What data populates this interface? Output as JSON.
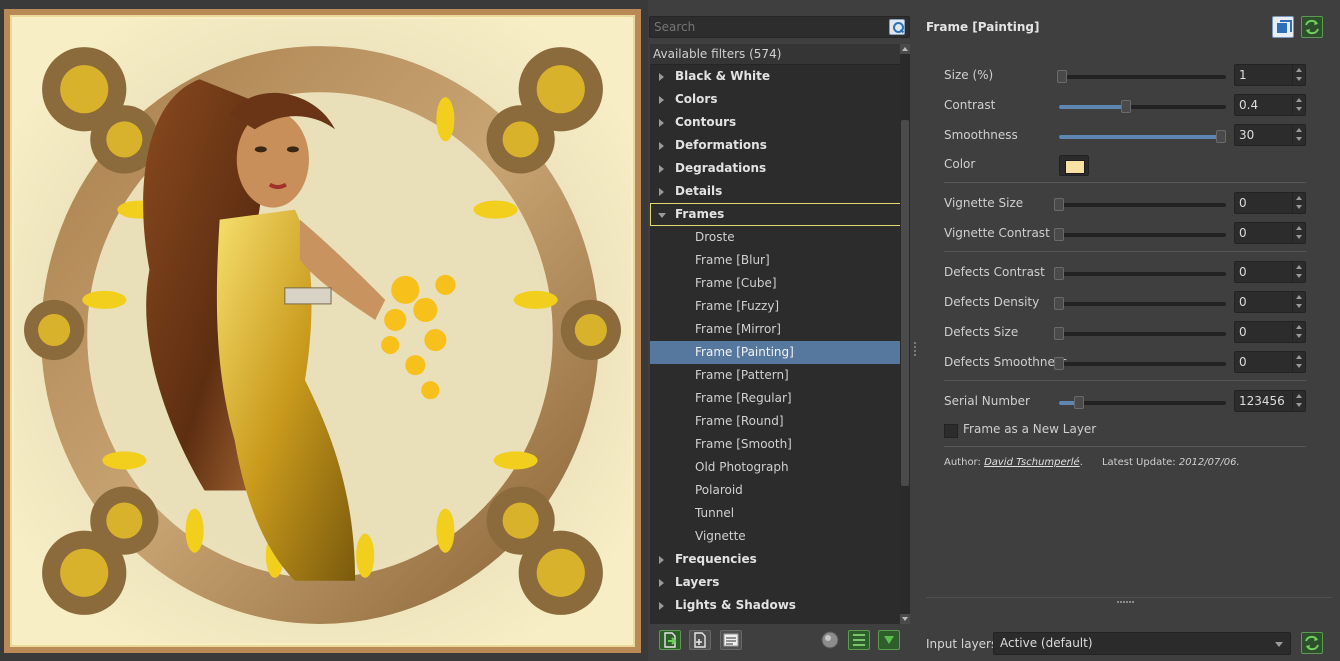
{
  "search": {
    "placeholder": "Search"
  },
  "tree": {
    "header": "Available filters (574)",
    "categories_before": [
      "Black & White",
      "Colors",
      "Contours",
      "Deformations",
      "Degradations",
      "Details"
    ],
    "open_category": "Frames",
    "frames_items": [
      "Droste",
      "Frame [Blur]",
      "Frame [Cube]",
      "Frame [Fuzzy]",
      "Frame [Mirror]",
      "Frame [Painting]",
      "Frame [Pattern]",
      "Frame [Regular]",
      "Frame [Round]",
      "Frame [Smooth]",
      "Old Photograph",
      "Polaroid",
      "Tunnel",
      "Vignette"
    ],
    "selected_item": "Frame [Painting]",
    "categories_after": [
      "Frequencies",
      "Layers",
      "Lights & Shadows"
    ]
  },
  "params": {
    "title": "Frame [Painting]",
    "size": {
      "label": "Size (%)",
      "value": "1",
      "level": 0.02
    },
    "contrast": {
      "label": "Contrast",
      "value": "0.4",
      "level": 0.4
    },
    "smoothness": {
      "label": "Smoothness",
      "value": "30",
      "level": 0.97
    },
    "color": {
      "label": "Color",
      "value": "#f7e2a4"
    },
    "vignette_size": {
      "label": "Vignette Size",
      "value": "0",
      "level": 0
    },
    "vignette_contrast": {
      "label": "Vignette Contrast",
      "value": "0",
      "level": 0
    },
    "defects_contrast": {
      "label": "Defects Contrast",
      "value": "0",
      "level": 0
    },
    "defects_density": {
      "label": "Defects Density",
      "value": "0",
      "level": 0
    },
    "defects_size": {
      "label": "Defects Size",
      "value": "0",
      "level": 0
    },
    "defects_smoothness": {
      "label": "Defects Smoothness",
      "value": "0",
      "level": 0
    },
    "serial_number": {
      "label": "Serial Number",
      "value": "123456",
      "level": 0.12
    },
    "new_layer": {
      "label": "Frame as a New Layer",
      "checked": false
    },
    "author_prefix": "Author:",
    "author_name": "David Tschumperlé",
    "author_suffix": ".",
    "update_label": "Latest Update:",
    "update_date": "2012/07/06."
  },
  "input_layers": {
    "label": "Input layers",
    "value": "Active (default)"
  },
  "colors": {
    "selection": "#56789e",
    "slider_fill": "#5d86b3",
    "highlight_outline": "#e3d96c"
  }
}
